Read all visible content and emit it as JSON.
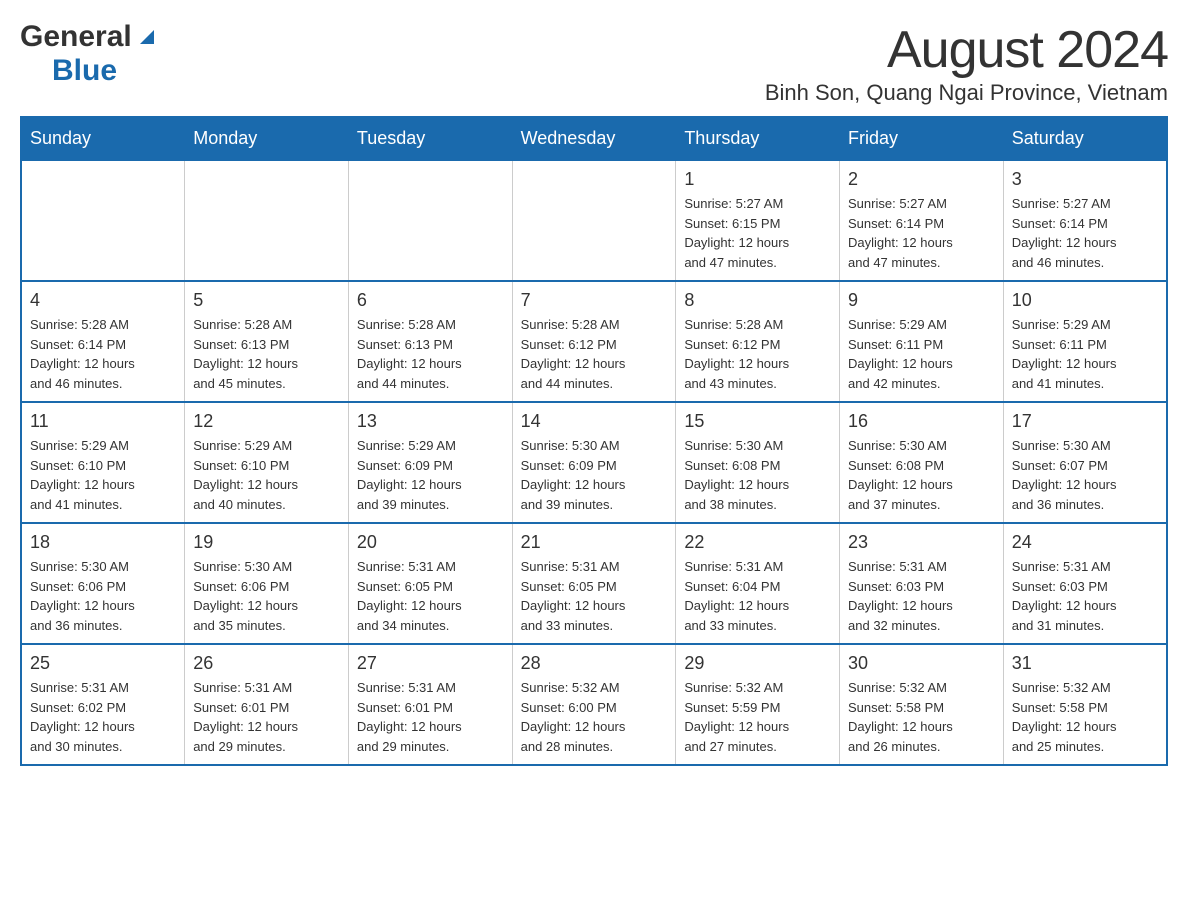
{
  "logo": {
    "general": "General",
    "blue": "Blue"
  },
  "title": "August 2024",
  "subtitle": "Binh Son, Quang Ngai Province, Vietnam",
  "days_of_week": [
    "Sunday",
    "Monday",
    "Tuesday",
    "Wednesday",
    "Thursday",
    "Friday",
    "Saturday"
  ],
  "weeks": [
    [
      {
        "day": "",
        "info": ""
      },
      {
        "day": "",
        "info": ""
      },
      {
        "day": "",
        "info": ""
      },
      {
        "day": "",
        "info": ""
      },
      {
        "day": "1",
        "info": "Sunrise: 5:27 AM\nSunset: 6:15 PM\nDaylight: 12 hours\nand 47 minutes."
      },
      {
        "day": "2",
        "info": "Sunrise: 5:27 AM\nSunset: 6:14 PM\nDaylight: 12 hours\nand 47 minutes."
      },
      {
        "day": "3",
        "info": "Sunrise: 5:27 AM\nSunset: 6:14 PM\nDaylight: 12 hours\nand 46 minutes."
      }
    ],
    [
      {
        "day": "4",
        "info": "Sunrise: 5:28 AM\nSunset: 6:14 PM\nDaylight: 12 hours\nand 46 minutes."
      },
      {
        "day": "5",
        "info": "Sunrise: 5:28 AM\nSunset: 6:13 PM\nDaylight: 12 hours\nand 45 minutes."
      },
      {
        "day": "6",
        "info": "Sunrise: 5:28 AM\nSunset: 6:13 PM\nDaylight: 12 hours\nand 44 minutes."
      },
      {
        "day": "7",
        "info": "Sunrise: 5:28 AM\nSunset: 6:12 PM\nDaylight: 12 hours\nand 44 minutes."
      },
      {
        "day": "8",
        "info": "Sunrise: 5:28 AM\nSunset: 6:12 PM\nDaylight: 12 hours\nand 43 minutes."
      },
      {
        "day": "9",
        "info": "Sunrise: 5:29 AM\nSunset: 6:11 PM\nDaylight: 12 hours\nand 42 minutes."
      },
      {
        "day": "10",
        "info": "Sunrise: 5:29 AM\nSunset: 6:11 PM\nDaylight: 12 hours\nand 41 minutes."
      }
    ],
    [
      {
        "day": "11",
        "info": "Sunrise: 5:29 AM\nSunset: 6:10 PM\nDaylight: 12 hours\nand 41 minutes."
      },
      {
        "day": "12",
        "info": "Sunrise: 5:29 AM\nSunset: 6:10 PM\nDaylight: 12 hours\nand 40 minutes."
      },
      {
        "day": "13",
        "info": "Sunrise: 5:29 AM\nSunset: 6:09 PM\nDaylight: 12 hours\nand 39 minutes."
      },
      {
        "day": "14",
        "info": "Sunrise: 5:30 AM\nSunset: 6:09 PM\nDaylight: 12 hours\nand 39 minutes."
      },
      {
        "day": "15",
        "info": "Sunrise: 5:30 AM\nSunset: 6:08 PM\nDaylight: 12 hours\nand 38 minutes."
      },
      {
        "day": "16",
        "info": "Sunrise: 5:30 AM\nSunset: 6:08 PM\nDaylight: 12 hours\nand 37 minutes."
      },
      {
        "day": "17",
        "info": "Sunrise: 5:30 AM\nSunset: 6:07 PM\nDaylight: 12 hours\nand 36 minutes."
      }
    ],
    [
      {
        "day": "18",
        "info": "Sunrise: 5:30 AM\nSunset: 6:06 PM\nDaylight: 12 hours\nand 36 minutes."
      },
      {
        "day": "19",
        "info": "Sunrise: 5:30 AM\nSunset: 6:06 PM\nDaylight: 12 hours\nand 35 minutes."
      },
      {
        "day": "20",
        "info": "Sunrise: 5:31 AM\nSunset: 6:05 PM\nDaylight: 12 hours\nand 34 minutes."
      },
      {
        "day": "21",
        "info": "Sunrise: 5:31 AM\nSunset: 6:05 PM\nDaylight: 12 hours\nand 33 minutes."
      },
      {
        "day": "22",
        "info": "Sunrise: 5:31 AM\nSunset: 6:04 PM\nDaylight: 12 hours\nand 33 minutes."
      },
      {
        "day": "23",
        "info": "Sunrise: 5:31 AM\nSunset: 6:03 PM\nDaylight: 12 hours\nand 32 minutes."
      },
      {
        "day": "24",
        "info": "Sunrise: 5:31 AM\nSunset: 6:03 PM\nDaylight: 12 hours\nand 31 minutes."
      }
    ],
    [
      {
        "day": "25",
        "info": "Sunrise: 5:31 AM\nSunset: 6:02 PM\nDaylight: 12 hours\nand 30 minutes."
      },
      {
        "day": "26",
        "info": "Sunrise: 5:31 AM\nSunset: 6:01 PM\nDaylight: 12 hours\nand 29 minutes."
      },
      {
        "day": "27",
        "info": "Sunrise: 5:31 AM\nSunset: 6:01 PM\nDaylight: 12 hours\nand 29 minutes."
      },
      {
        "day": "28",
        "info": "Sunrise: 5:32 AM\nSunset: 6:00 PM\nDaylight: 12 hours\nand 28 minutes."
      },
      {
        "day": "29",
        "info": "Sunrise: 5:32 AM\nSunset: 5:59 PM\nDaylight: 12 hours\nand 27 minutes."
      },
      {
        "day": "30",
        "info": "Sunrise: 5:32 AM\nSunset: 5:58 PM\nDaylight: 12 hours\nand 26 minutes."
      },
      {
        "day": "31",
        "info": "Sunrise: 5:32 AM\nSunset: 5:58 PM\nDaylight: 12 hours\nand 25 minutes."
      }
    ]
  ]
}
